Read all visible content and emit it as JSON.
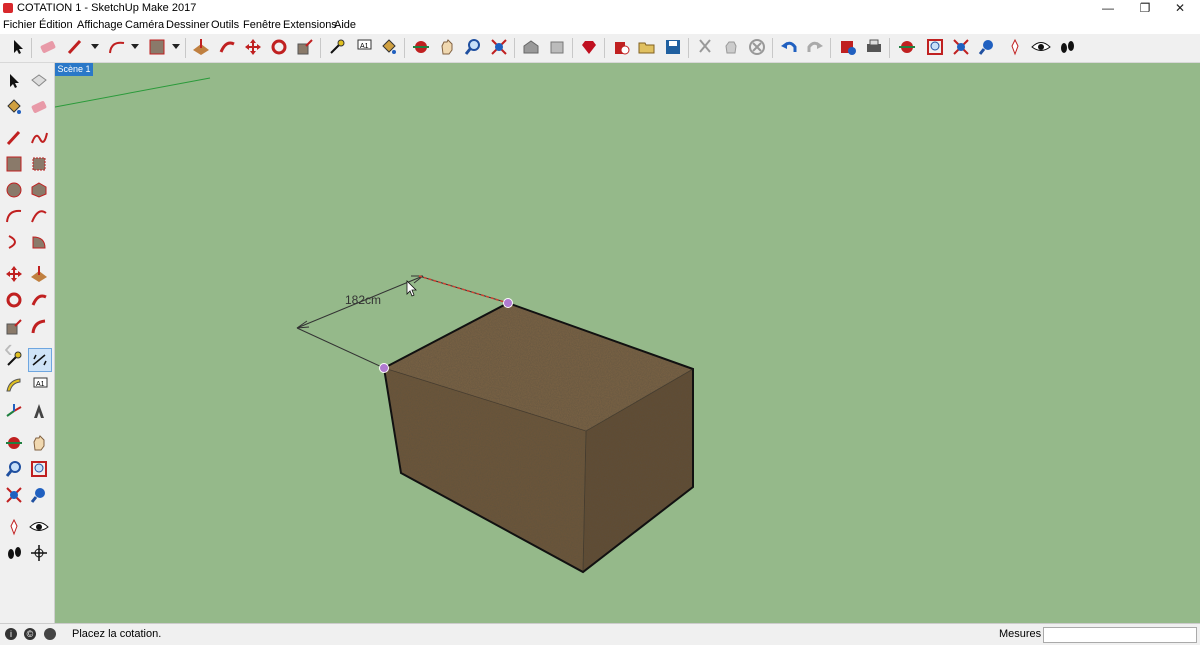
{
  "window": {
    "title": "COTATION 1 - SketchUp Make 2017",
    "minimize_symbol": "—",
    "restore_symbol": "❐",
    "close_symbol": "✕"
  },
  "menu": [
    {
      "label": "Fichier"
    },
    {
      "label": "Édition"
    },
    {
      "label": "Affichage"
    },
    {
      "label": "Caméra"
    },
    {
      "label": "Dessiner"
    },
    {
      "label": "Outils"
    },
    {
      "label": "Fenêtre"
    },
    {
      "label": "Extensions"
    },
    {
      "label": "Aide"
    }
  ],
  "scene_tab": {
    "label": "Scène 1"
  },
  "viewport": {
    "background_color": "#95b98a",
    "dimension_label": "182cm",
    "box_color": "#7a5f3e"
  },
  "statusbar": {
    "text": "Placez la cotation.",
    "measures_label": "Mesures",
    "measures_value": "",
    "geo_icon": "i",
    "credit_icon": "©"
  }
}
